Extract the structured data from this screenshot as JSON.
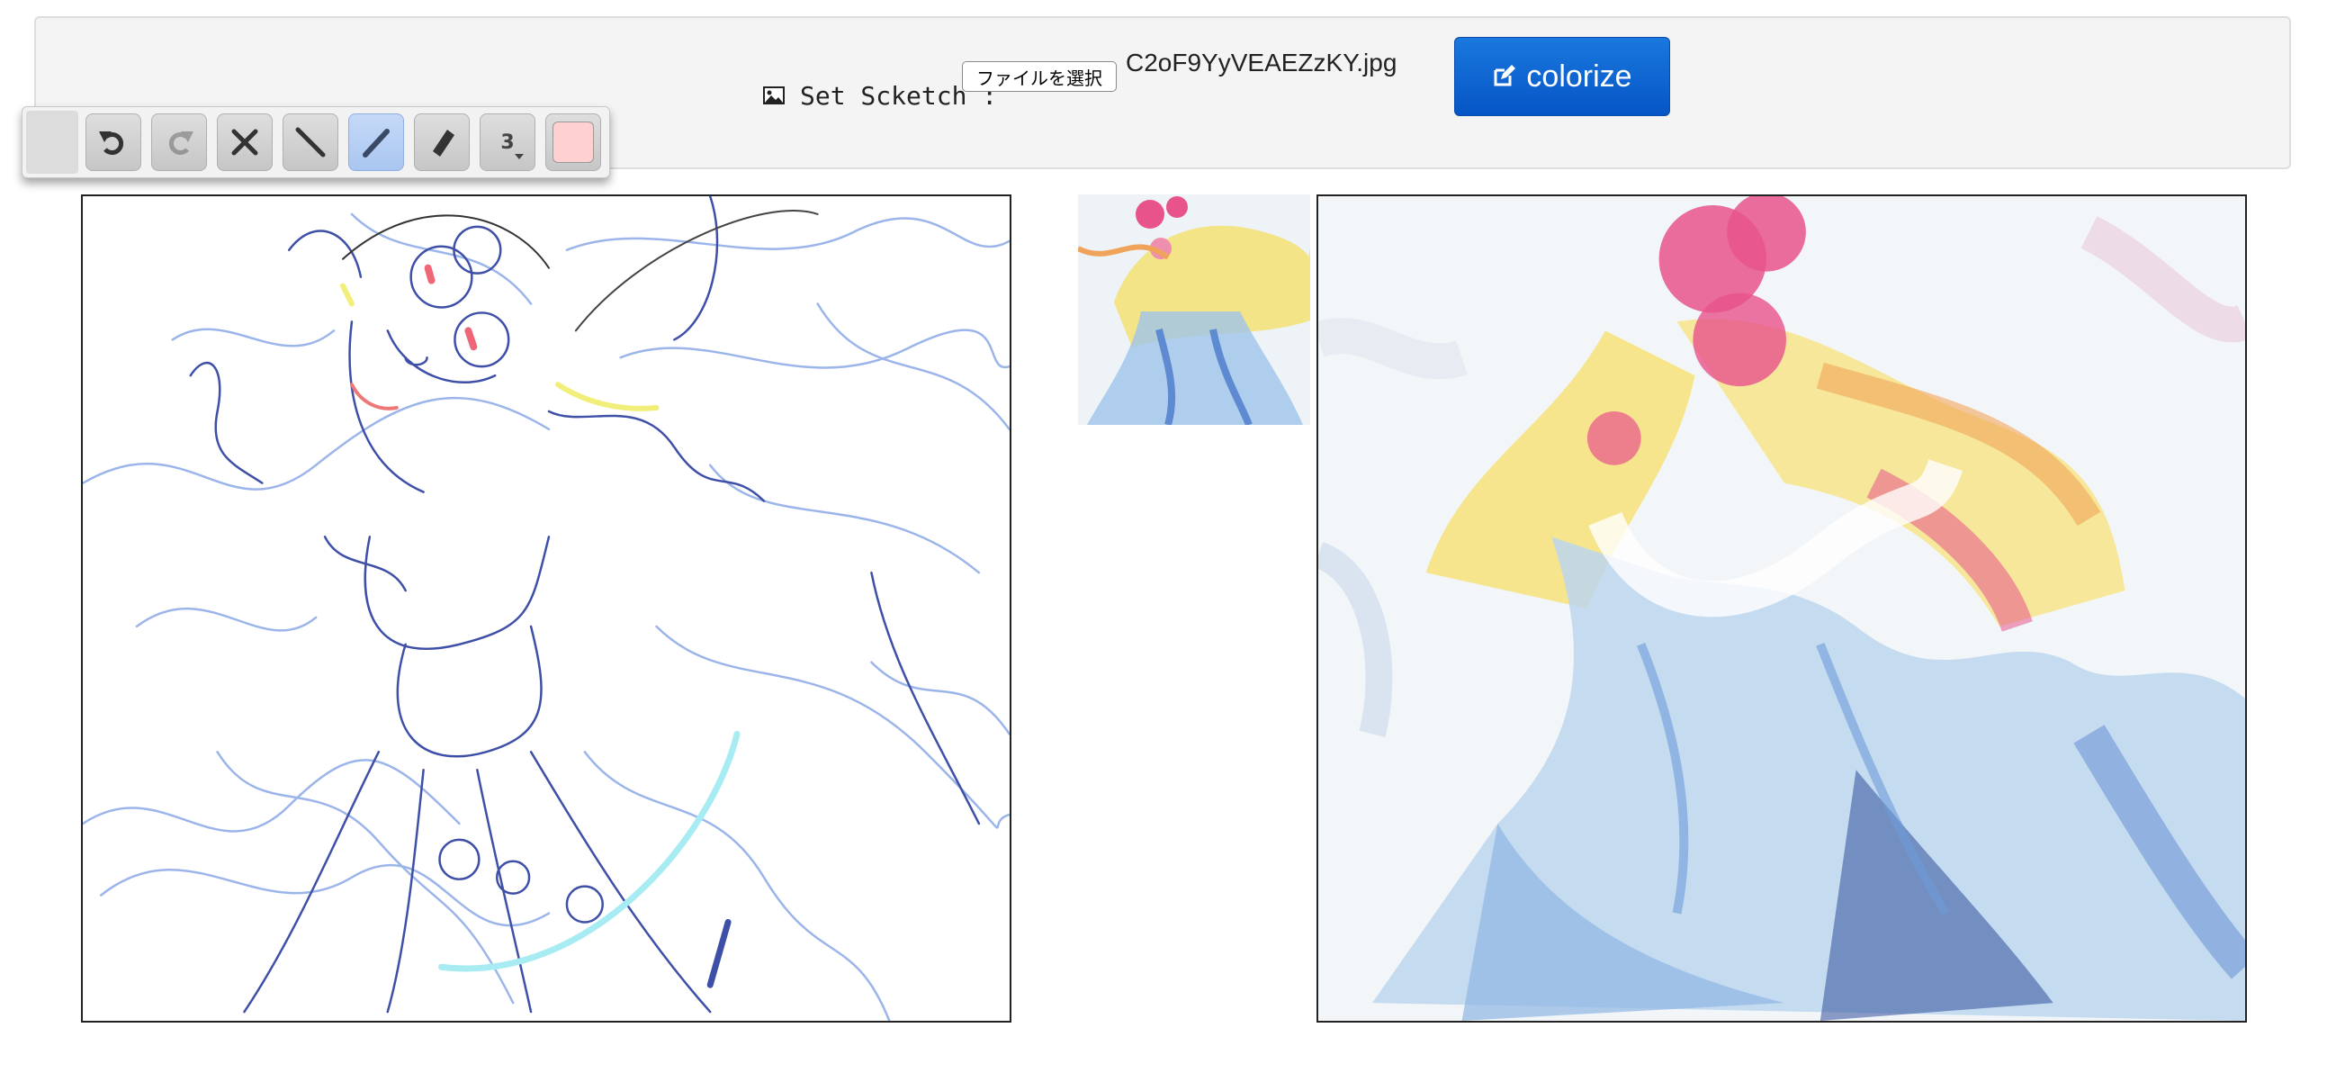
{
  "header": {
    "set_sketch_label": "Set Scketch :",
    "file_button_label": "ファイルを選択",
    "file_name": "C2oF9YyVEAEZzKY.jpg",
    "colorize_label": "colorize"
  },
  "toolbar": {
    "brush_size": "3",
    "selected_color": "#ffd0d0",
    "tools": [
      "undo-icon",
      "redo-icon",
      "clear-icon",
      "line-icon",
      "pen-icon",
      "eraser-icon",
      "size-icon",
      "color-swatch"
    ]
  },
  "colors": {
    "accent": "#0a64d6",
    "active_tool": "#b6cff4"
  }
}
